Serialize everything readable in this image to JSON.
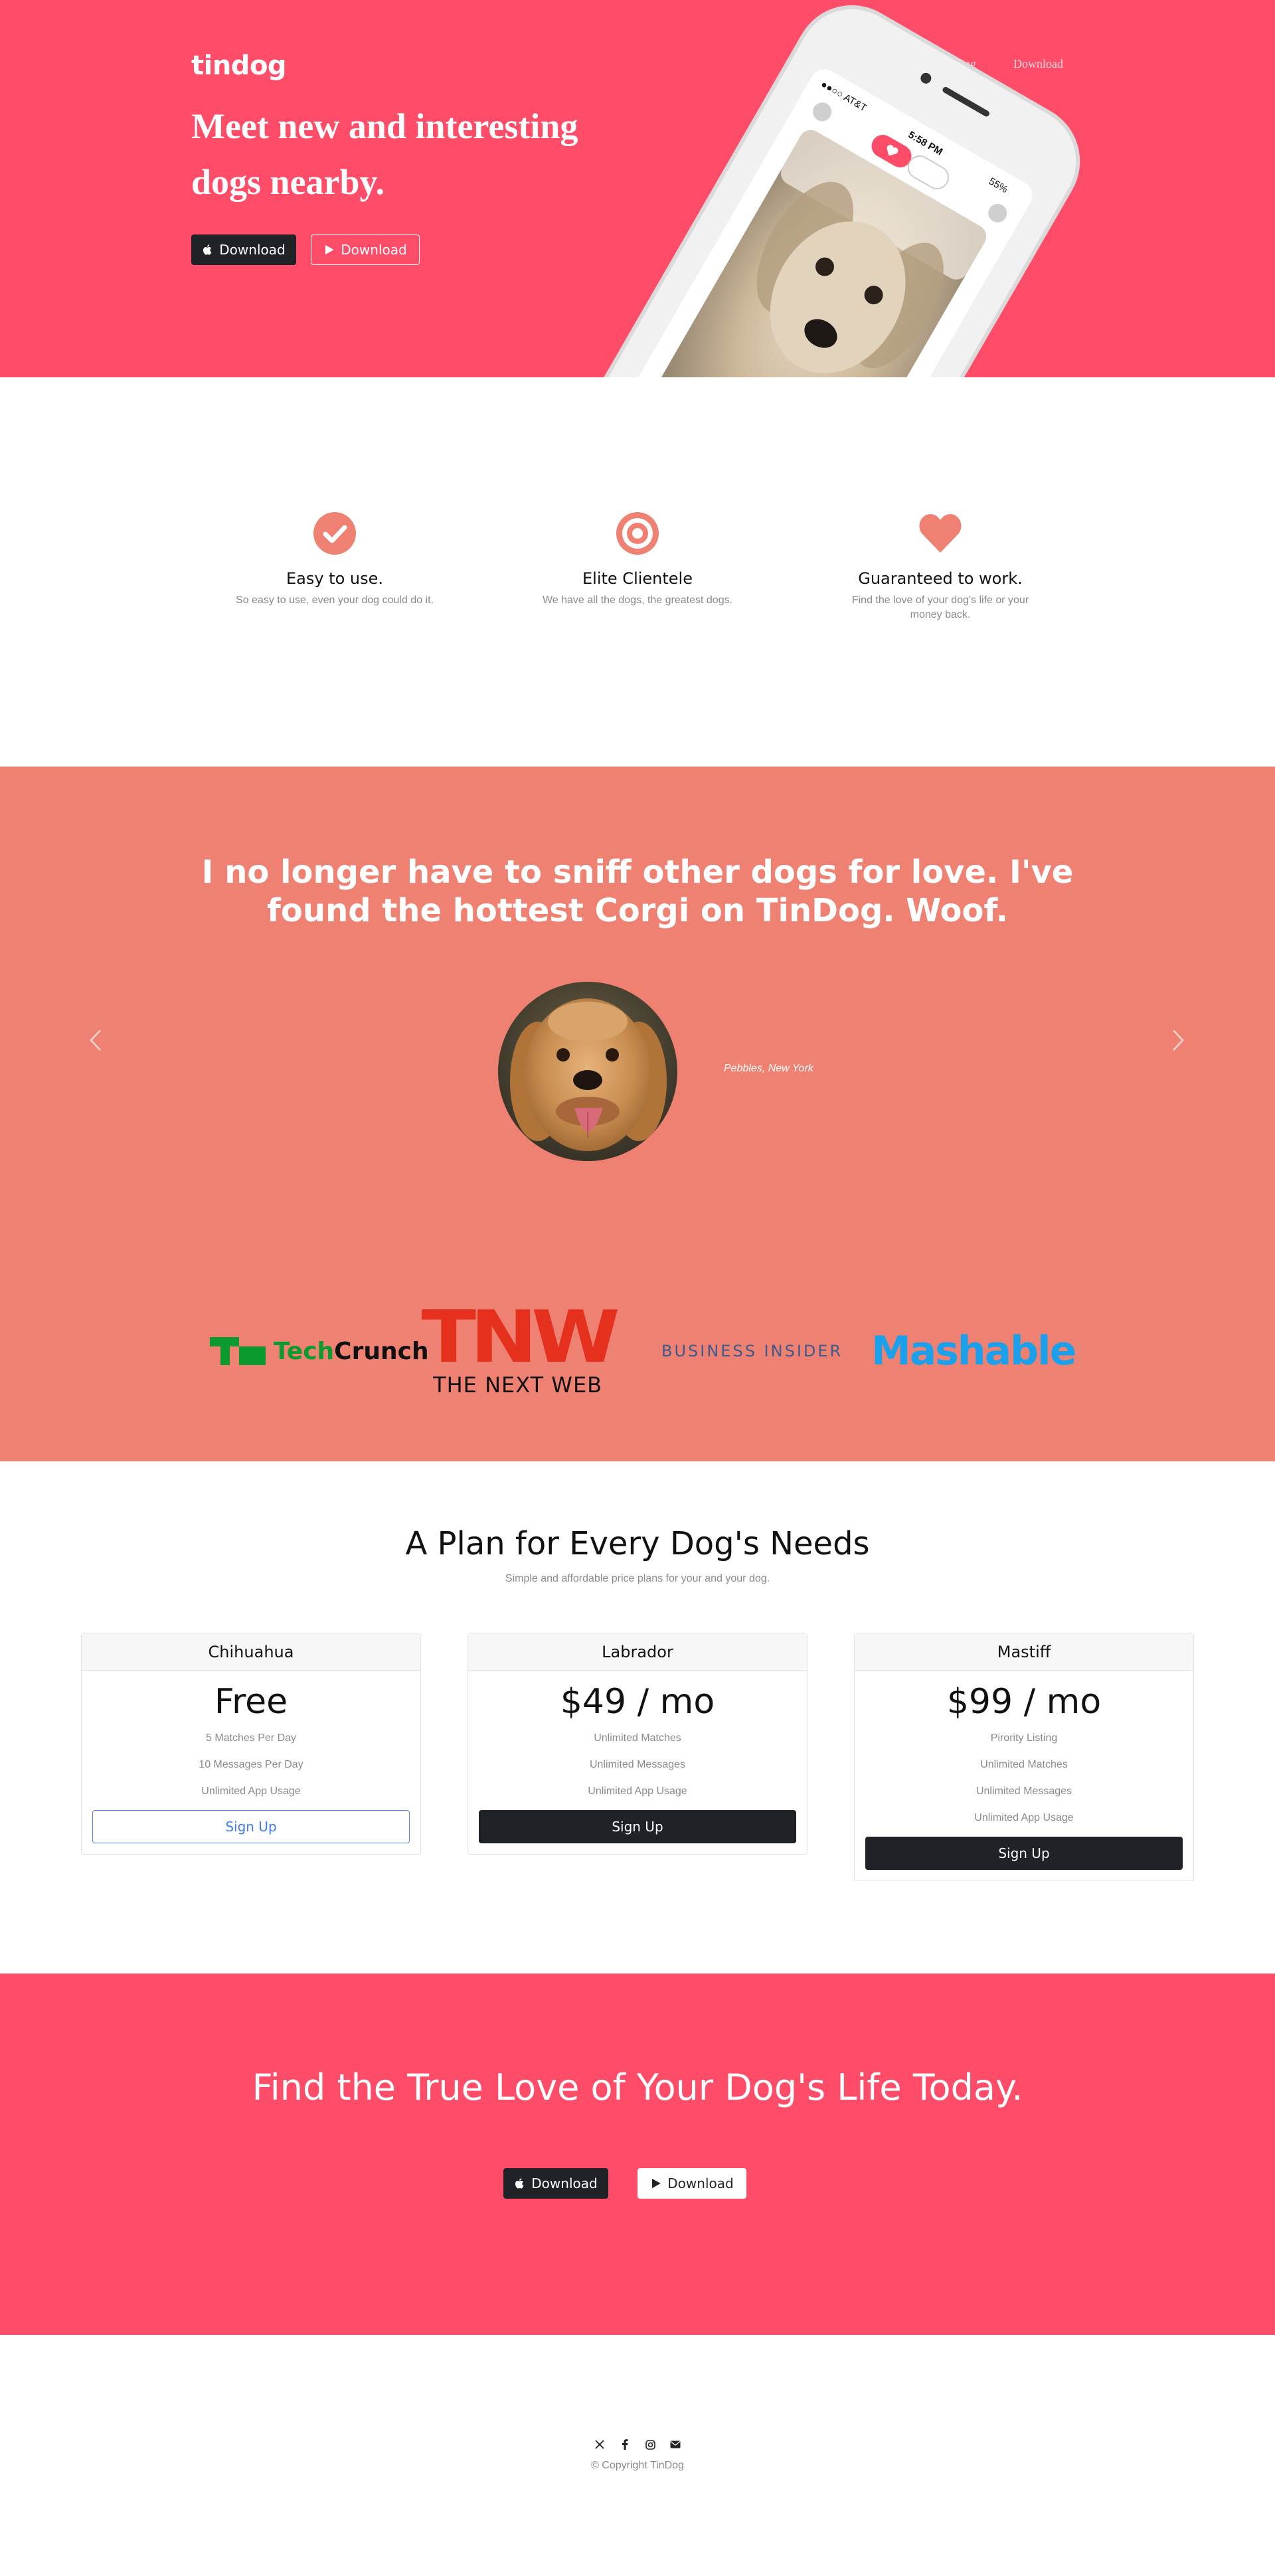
{
  "colors": {
    "brand_pink": "#ff4c68",
    "coral": "#ef8172",
    "dark": "#1f2227",
    "muted_text": "#8a8a8a",
    "signup_blue": "#3f7de8"
  },
  "nav": {
    "brand": "tindog",
    "links": [
      "Contact",
      "Pricing",
      "Download"
    ]
  },
  "hero": {
    "title": "Meet new and interesting dogs nearby.",
    "buttons": [
      {
        "label": "Download",
        "icon": "apple-icon"
      },
      {
        "label": "Download",
        "icon": "google-play-icon"
      }
    ],
    "phone": {
      "carrier": "AT&T",
      "time": "5:58 PM",
      "battery": "55%"
    }
  },
  "features": [
    {
      "icon": "check-circle-icon",
      "title": "Easy to use.",
      "text": "So easy to use, even your dog could do it."
    },
    {
      "icon": "bullseye-icon",
      "title": "Elite Clientele",
      "text": "We have all the dogs, the greatest dogs."
    },
    {
      "icon": "heart-icon",
      "title": "Guaranteed to work.",
      "text": "Find the love of your dog's life or your money back."
    }
  ],
  "testimonial": {
    "quote": "I no longer have to sniff other dogs for love. I've found the hottest Corgi on TinDog. Woof.",
    "attribution": "Pebbles, New York"
  },
  "press": {
    "techcrunch": {
      "mark": "TC",
      "part1": "Tech",
      "part2": "Crunch"
    },
    "tnw": {
      "big": "TNW",
      "small": "THE NEXT WEB"
    },
    "business_insider": "BUSINESS INSIDER",
    "mashable": "Mashable"
  },
  "pricing": {
    "title": "A Plan for Every Dog's Needs",
    "subtitle": "Simple and affordable price plans for your and your dog.",
    "plans": [
      {
        "name": "Chihuahua",
        "price": "Free",
        "features": [
          "5 Matches Per Day",
          "10 Messages Per Day",
          "Unlimited App Usage"
        ],
        "cta": "Sign Up"
      },
      {
        "name": "Labrador",
        "price": "$49 / mo",
        "features": [
          "Unlimited Matches",
          "Unlimited Messages",
          "Unlimited App Usage"
        ],
        "cta": "Sign Up"
      },
      {
        "name": "Mastiff",
        "price": "$99 / mo",
        "features": [
          "Pirority Listing",
          "Unlimited Matches",
          "Unlimited Messages",
          "Unlimited App Usage"
        ],
        "cta": "Sign Up"
      }
    ]
  },
  "cta": {
    "title": "Find the True Love of Your Dog's Life Today.",
    "buttons": [
      {
        "label": "Download",
        "icon": "apple-icon"
      },
      {
        "label": "Download",
        "icon": "google-play-icon"
      }
    ]
  },
  "footer": {
    "social_icons": [
      "x-twitter-icon",
      "facebook-icon",
      "instagram-icon",
      "envelope-icon"
    ],
    "copyright": "© Copyright TinDog"
  }
}
